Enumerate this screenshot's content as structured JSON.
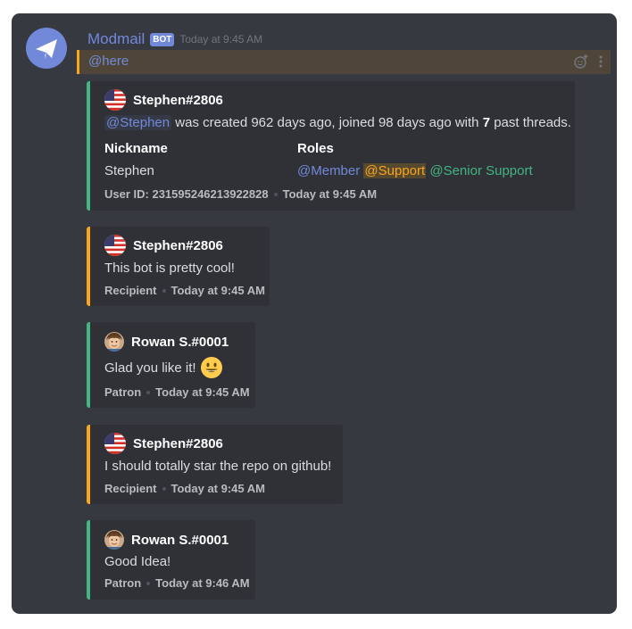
{
  "bot_message": {
    "username": "Modmail",
    "bot_tag": "BOT",
    "timestamp": "Today at 9:45 AM",
    "mention": "@here"
  },
  "thread_info": {
    "author": "Stephen#2806",
    "mention": "@Stephen",
    "desc_part1": " was created 962 days ago, joined 98 days ago with ",
    "past_threads": "7",
    "desc_part2": " past threads.",
    "field_nickname_label": "Nickname",
    "field_nickname_value": "Stephen",
    "field_roles_label": "Roles",
    "roles": [
      "@Member",
      "@Support",
      "@Senior Support"
    ],
    "footer_user_id": "User ID: 231595246213922828",
    "footer_time": "Today at 9:45 AM"
  },
  "messages": [
    {
      "author": "Stephen#2806",
      "text": "This bot is pretty cool!",
      "role": "Recipient",
      "time": "Today at 9:45 AM",
      "avatar": "us-flag-icon"
    },
    {
      "author": "Rowan S.#0001",
      "text": "Glad you like it!",
      "role": "Patron",
      "time": "Today at 9:45 AM",
      "avatar": "user-photo"
    },
    {
      "author": "Stephen#2806",
      "text": "I should totally star the repo on github!",
      "role": "Recipient",
      "time": "Today at 9:45 AM",
      "avatar": "us-flag-icon"
    },
    {
      "author": "Rowan S.#0001",
      "text": "Good Idea!",
      "role": "Patron",
      "time": "Today at 9:46 AM",
      "avatar": "user-photo"
    }
  ],
  "colors": {
    "background": "#36393f",
    "embed": "#2f3136",
    "blurple": "#7289da",
    "recipient_bar": "#faa61a",
    "staff_bar": "#43b581"
  }
}
